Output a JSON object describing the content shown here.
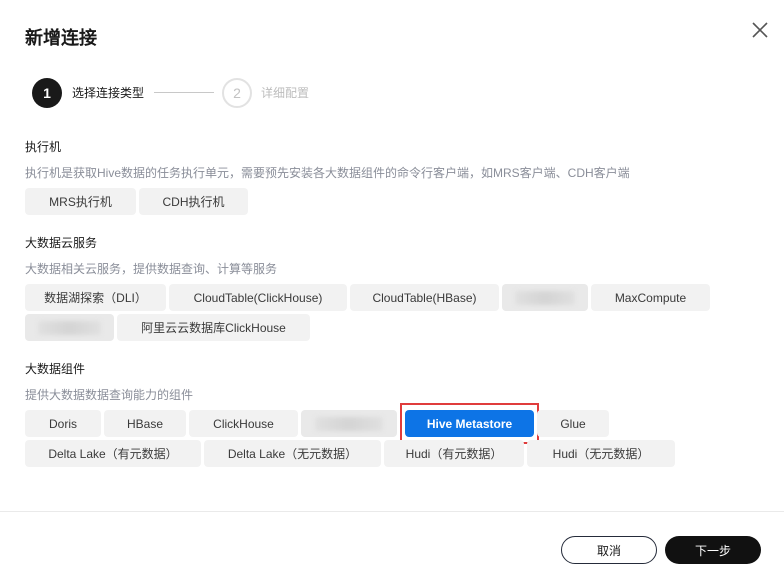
{
  "dialog": {
    "title": "新增连接",
    "close_icon": "close-icon"
  },
  "steps": [
    {
      "number": "1",
      "label": "选择连接类型",
      "state": "active"
    },
    {
      "number": "2",
      "label": "详细配置",
      "state": "inactive"
    }
  ],
  "sections": {
    "executor": {
      "title": "执行机",
      "desc": "执行机是获取Hive数据的任务执行单元，需要预先安装各大数据组件的命令行客户端，如MRS客户端、CDH客户端",
      "items": [
        "MRS执行机",
        "CDH执行机"
      ]
    },
    "cloud": {
      "title": "大数据云服务",
      "desc": "大数据相关云服务，提供数据查询、计算等服务",
      "items": [
        "数据湖探索（DLI）",
        "CloudTable(ClickHouse)",
        "CloudTable(HBase)",
        "",
        "MaxCompute",
        "",
        "阿里云云数据库ClickHouse"
      ]
    },
    "components": {
      "title": "大数据组件",
      "desc": "提供大数据数据查询能力的组件",
      "items": [
        "Doris",
        "HBase",
        "ClickHouse",
        "",
        "Hive Metastore",
        "Glue",
        "Delta Lake（有元数据）",
        "Delta Lake（无元数据）",
        "Hudi（有元数据）",
        "Hudi（无元数据）"
      ]
    }
  },
  "footer": {
    "cancel_label": "取消",
    "next_label": "下一步"
  },
  "colors": {
    "selected": "#0d74e6",
    "highlight_border": "#e03c3c",
    "primary_button": "#111111"
  }
}
